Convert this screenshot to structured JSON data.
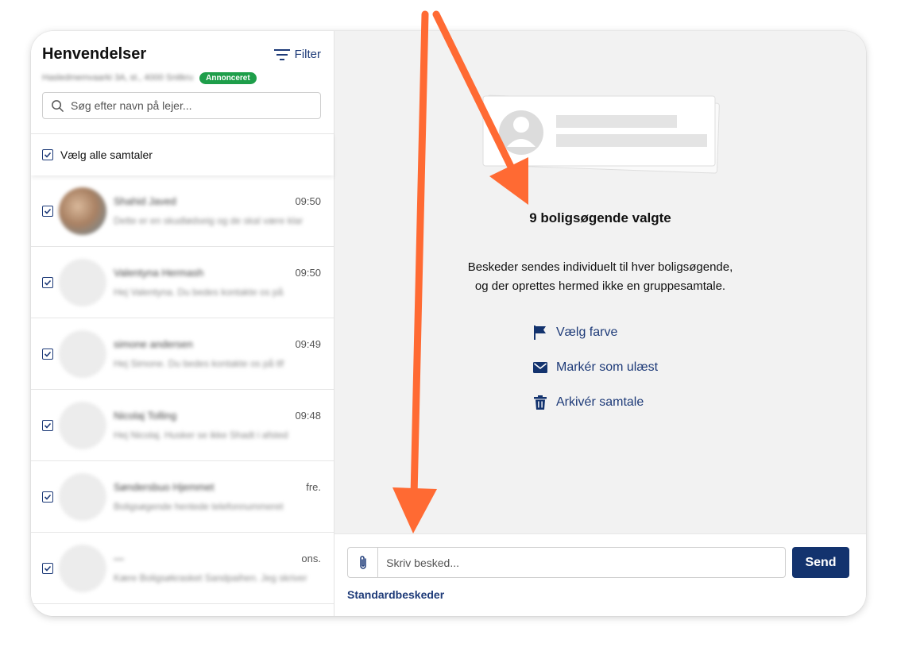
{
  "sidebar": {
    "title": "Henvendelser",
    "filter_label": "Filter",
    "address": "Hasledmemvaarki 3A, st., 4000 Snitkru",
    "status_badge": "Annonceret",
    "search_placeholder": "Søg efter navn på lejer...",
    "select_all_label": "Vælg alle samtaler",
    "conversations": [
      {
        "name": "Shahid Javed",
        "time": "09:50",
        "preview": "Dette er en skudlødseig og de skal være klar",
        "avatar": "photo",
        "checked": true
      },
      {
        "name": "Valentyna Hermash",
        "time": "09:50",
        "preview": "Hej Valentyna. Du bedes kontakte os på",
        "avatar": "placeholder",
        "checked": true
      },
      {
        "name": "simone andersen",
        "time": "09:49",
        "preview": "Hej Simone. Du bedes kontakte os på tlf",
        "avatar": "placeholder",
        "checked": true
      },
      {
        "name": "Nicolaj Tolling",
        "time": "09:48",
        "preview": "Hej Nicolaj. Husker se ikke Shadt i afsted",
        "avatar": "placeholder",
        "checked": true
      },
      {
        "name": "Søndersbuo Hjemmet",
        "time": "fre.",
        "preview": "Boligsøgende hentede telefonnummeret",
        "avatar": "placeholder",
        "checked": true
      },
      {
        "name": "—",
        "time": "ons.",
        "preview": "Kære Boligsøkrasket Sandpaihen. Jeg skriver",
        "avatar": "placeholder",
        "checked": true
      }
    ]
  },
  "main": {
    "selected_title": "9 boligsøgende valgte",
    "description_line1": "Beskeder sendes individuelt til hver boligsøgende,",
    "description_line2": "og der oprettes hermed ikke en gruppesamtale.",
    "actions": [
      {
        "label": "Vælg farve",
        "icon": "flag-icon"
      },
      {
        "label": "Markér som ulæst",
        "icon": "envelope-icon"
      },
      {
        "label": "Arkivér samtale",
        "icon": "trash-icon"
      }
    ]
  },
  "composer": {
    "placeholder": "Skriv besked...",
    "send_label": "Send",
    "templates_label": "Standardbeskeder"
  },
  "colors": {
    "primary": "#13336e",
    "link": "#1d3a78",
    "badge": "#1e9e4a",
    "annotation_arrow": "#ff6a33",
    "panel_bg": "#f2f2f2"
  }
}
